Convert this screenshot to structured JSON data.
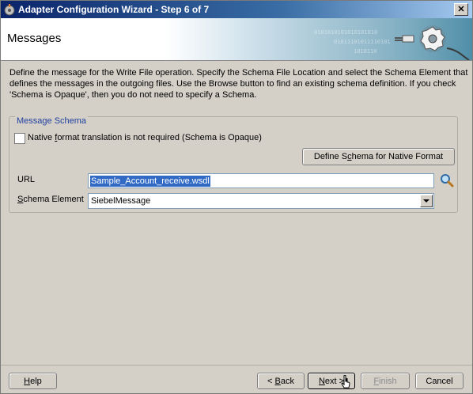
{
  "window": {
    "title": "Adapter Configuration Wizard - Step 6 of 7",
    "close_glyph": "✕"
  },
  "header": {
    "title": "Messages"
  },
  "description": {
    "line1": "Define the message for the Write File operation.  Specify the Schema File Location and select the Schema Element that",
    "line2": "defines the messages in the outgoing files. Use the Browse button to find an existing schema definition. If you check",
    "line3": "'Schema is Opaque', then you do not need to specify a Schema."
  },
  "schema": {
    "legend": "Message Schema",
    "native_checkbox": {
      "label": "Native format translation is not required (Schema is Opaque)",
      "checked": false
    },
    "define_button": "Define Schema for Native Format",
    "url_label": "URL",
    "url_value": "Sample_Account_receive.wsdl",
    "element_label": "Schema Element",
    "element_value": "SiebelMessage"
  },
  "buttons": {
    "help": "Help",
    "back": "< Back",
    "next": "Next >",
    "finish": "Finish",
    "cancel": "Cancel"
  },
  "icons": {
    "app": "adapter-icon",
    "search": "search-icon",
    "banner": "gear-plug-icon"
  }
}
